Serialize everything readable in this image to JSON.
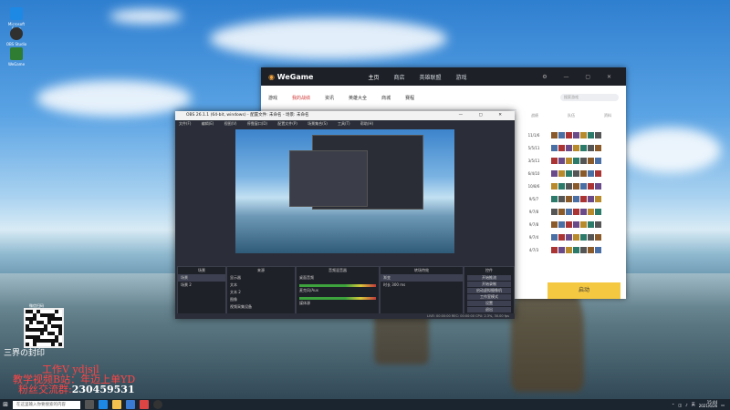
{
  "desktop": {
    "icons": [
      {
        "label": "Microsoft Edge",
        "color": "#1e88e5"
      },
      {
        "label": "OBS Studio",
        "color": "#303030"
      },
      {
        "label": "WeGame",
        "color": "#2e7d32"
      }
    ]
  },
  "wegame": {
    "logo": "WeGame",
    "tabs": [
      "主页",
      "商店",
      "英雄联盟",
      "游戏"
    ],
    "subnav": [
      "游戏",
      "我的战绩",
      "资讯",
      "英雄大全",
      "商城",
      "赛程"
    ],
    "search_placeholder": "搜索游戏",
    "right_header": [
      "战绩",
      "队伍",
      "资料"
    ],
    "match_rows": [
      {
        "kda": "11/1/6"
      },
      {
        "kda": "5/5/11"
      },
      {
        "kda": "3/5/11"
      },
      {
        "kda": "6/4/10"
      },
      {
        "kda": "10/8/6"
      },
      {
        "kda": "9/5/7"
      },
      {
        "kda": "9/7/8"
      },
      {
        "kda": "9/7/8"
      },
      {
        "kda": "9/7/4"
      },
      {
        "kda": "4/7/3"
      }
    ],
    "start_button": "启动"
  },
  "obs": {
    "title": "OBS 26.1.1 (64-bit, windows) - 配置文件: 未命名 - 场景: 未命名",
    "menu": [
      "文件(F)",
      "编辑(E)",
      "视图(V)",
      "停靠窗口(D)",
      "配置文件(P)",
      "场景集合(S)",
      "工具(T)",
      "帮助(H)"
    ],
    "docks": {
      "scenes_header": "场景",
      "scenes": [
        "场景",
        "场景 2"
      ],
      "sources_header": "来源",
      "sources": [
        "显示器",
        "文本",
        "文本 2",
        "图像",
        "视频采集设备"
      ],
      "mixer_header": "音频混音器",
      "mixer_tracks": [
        "桌面音频",
        "麦克风/Aux",
        "媒体源"
      ],
      "transitions_header": "转场特效",
      "transition_value": "渐变",
      "duration_label": "时长",
      "duration_value": "300 ms",
      "controls_header": "控件",
      "controls": [
        "开始推流",
        "开始录制",
        "启动虚拟摄像机",
        "工作室模式",
        "设置",
        "退出"
      ]
    },
    "status": "LIVE: 00:00:00   REC: 00:00:00   CPU: 2.3%, 30.00 fps"
  },
  "overlay": {
    "qr_caption": "微信扫码",
    "figure_logo": "三界の封印",
    "line1_label": "工作V ",
    "line1_value": "ydjsjl",
    "line2": "教学视频B站：年迈上单YD",
    "line3_label": "粉丝交流群:",
    "line3_value": "230459531"
  },
  "taskbar": {
    "search_placeholder": "在这里输入你要搜索的内容",
    "time": "15:44",
    "date": "2021/6/26",
    "lang": "英"
  }
}
